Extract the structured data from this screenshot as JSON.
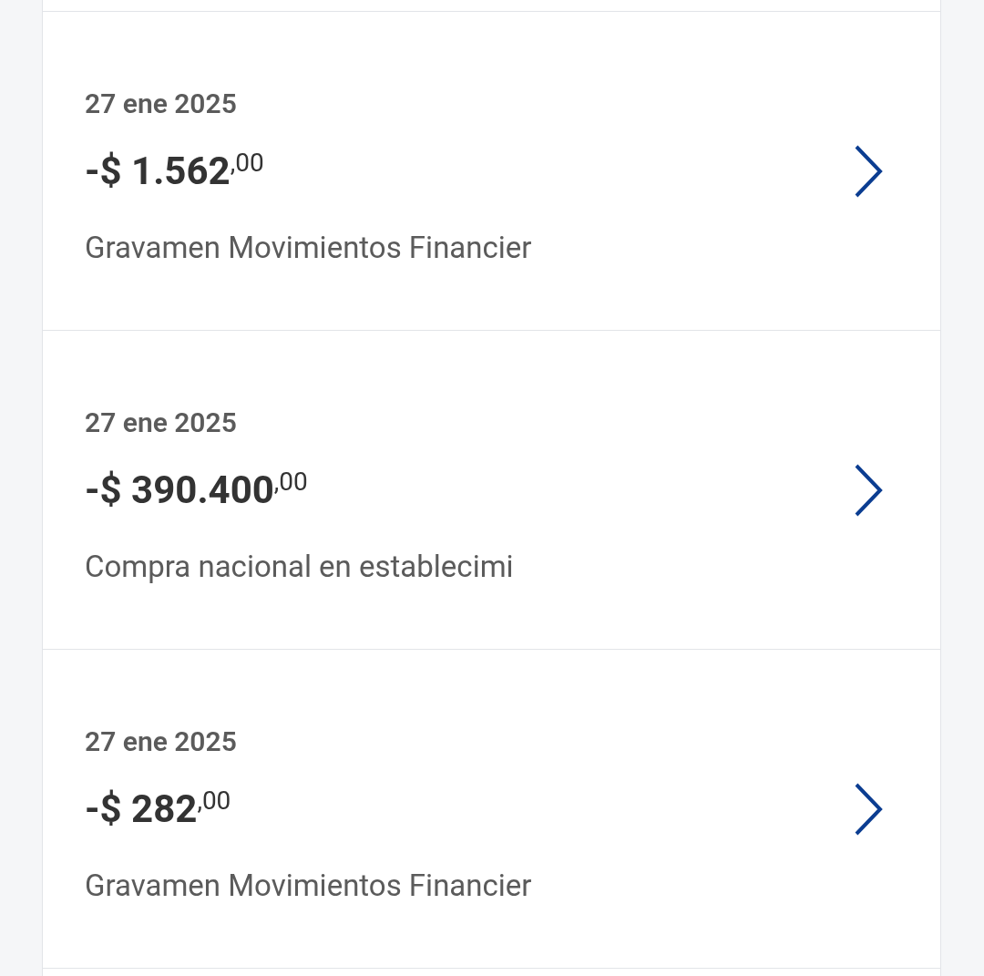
{
  "transactions": [
    {
      "date": "27 ene 2025",
      "amount": "-$ 1.562$^{,00}$",
      "description": "Gravamen Movimientos Financier"
    },
    {
      "date": "27 ene 2025",
      "amount": "-$ 390.400$^{,00}$",
      "description": "Compra nacional en establecimi"
    },
    {
      "date": "27 ene 2025",
      "amount": "-$ 282$^{,00}$",
      "description": "Gravamen Movimientos Financier"
    }
  ]
}
